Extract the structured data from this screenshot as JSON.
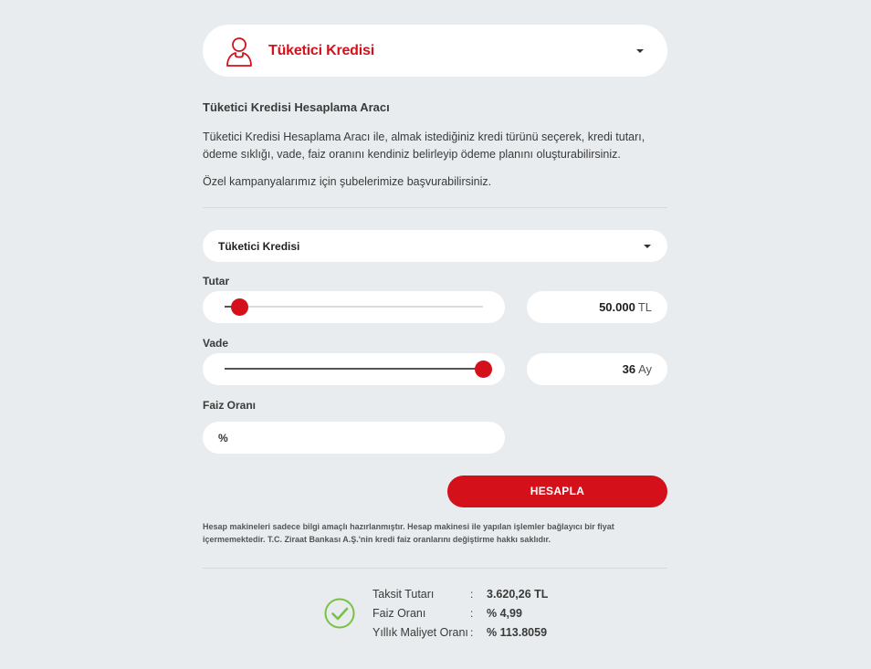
{
  "header": {
    "selected_product": "Tüketici Kredisi"
  },
  "intro": {
    "heading": "Tüketici Kredisi Hesaplama Aracı",
    "description": "Tüketici Kredisi Hesaplama Aracı ile, almak istediğiniz kredi türünü seçerek, kredi tutarı, ödeme sıklığı, vade, faiz oranını kendiniz belirleyip ödeme planını oluşturabilirsiniz.",
    "campaign_note": "Özel kampanyalarımız için şubelerimize başvurabilirsiniz."
  },
  "form": {
    "credit_type": "Tüketici Kredisi",
    "amount": {
      "label": "Tutar",
      "value": "50.000",
      "unit": "TL",
      "slider_fraction": 0.06
    },
    "term": {
      "label": "Vade",
      "value": "36",
      "unit": "Ay",
      "slider_fraction": 1.0
    },
    "rate": {
      "label": "Faiz Oranı",
      "prefix": "%"
    },
    "calculate_label": "HESAPLA"
  },
  "disclaimer": "Hesap makineleri sadece bilgi amaçlı hazırlanmıştır. Hesap makinesi ile yapılan işlemler bağlayıcı bir fiyat içermemektedir. T.C. Ziraat Bankası A.Ş.'nin kredi faiz oranlarını değiştirme hakkı saklıdır.",
  "results": [
    {
      "label": "Taksit Tutarı",
      "value": "3.620,26 TL"
    },
    {
      "label": "Faiz Oranı",
      "value": "% 4,99"
    },
    {
      "label": "Yıllık Maliyet Oranı",
      "value": "% 113.8059"
    }
  ],
  "colors": {
    "accent": "#d4111b",
    "success": "#7ac143",
    "background": "#e8ecee"
  },
  "icons": {
    "header": "user-icon",
    "result": "check-circle-icon",
    "dropdown": "chevron-down-icon"
  }
}
